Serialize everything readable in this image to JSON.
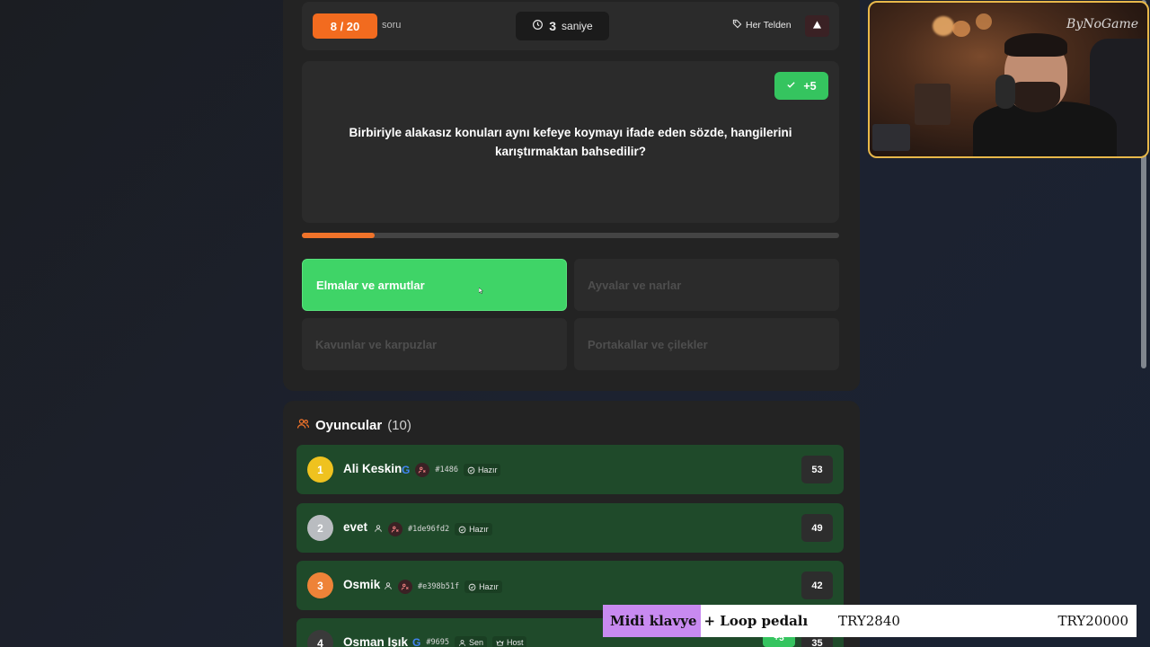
{
  "quiz": {
    "counter": "8 / 20",
    "counter_suffix": "soru",
    "timer_value": "3",
    "timer_unit": "saniye",
    "category": "Her Telden",
    "points": "+5",
    "question": "Birbiriyle alakasız konuları aynı kefeye koymayı ifade eden sözde, hangilerini karıştırmaktan bahsedilir?",
    "progress_fraction": 0.135,
    "answers": [
      {
        "label": "Elmalar ve armutlar",
        "state": "correct"
      },
      {
        "label": "Ayvalar ve narlar",
        "state": "dimmed"
      },
      {
        "label": "Kavunlar ve karpuzlar",
        "state": "dimmed"
      },
      {
        "label": "Portakallar ve çilekler",
        "state": "dimmed"
      }
    ]
  },
  "players": {
    "title": "Oyuncular",
    "count": "(10)",
    "rows": [
      {
        "rank": "1",
        "name": "Ali Keskin",
        "id": "#1486",
        "status": "Hazır",
        "score": "53"
      },
      {
        "rank": "2",
        "name": "evet",
        "id": "#1de96fd2",
        "status": "Hazır",
        "score": "49"
      },
      {
        "rank": "3",
        "name": "Osmik",
        "id": "#e398b51f",
        "status": "Hazır",
        "score": "42"
      },
      {
        "rank": "4",
        "name": "Osman Işık",
        "id": "#9695",
        "you": "Sen",
        "host": "Host",
        "gain": "+5",
        "score": "35"
      }
    ]
  },
  "webcam": {
    "logo": "ByNoGame"
  },
  "ticker": {
    "tag": "Midi klavye",
    "rest": "+ Loop pedalı",
    "price1": "TRY2840",
    "price2": "TRY20000"
  },
  "colors": {
    "accent_orange": "#f26b1f",
    "correct_green": "#3fd467",
    "row_green": "#1f4a2a"
  }
}
